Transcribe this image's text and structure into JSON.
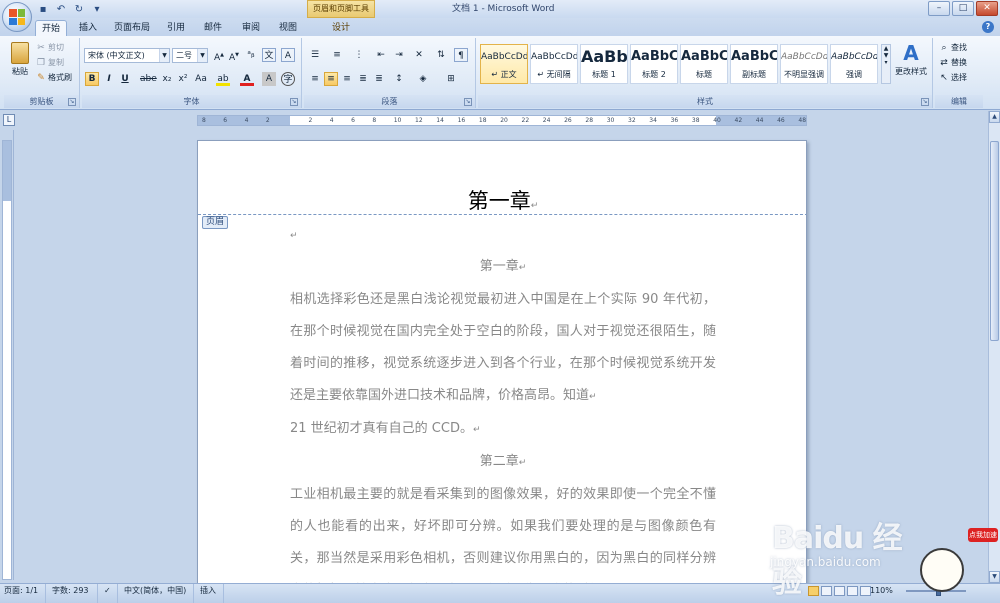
{
  "titlebar": {
    "context_tool": "页眉和页脚工具",
    "doc_title": "文档 1 - Microsoft Word"
  },
  "tabs": {
    "home": "开始",
    "insert": "插入",
    "layout": "页面布局",
    "references": "引用",
    "mailings": "邮件",
    "review": "审阅",
    "view": "视图",
    "design": "设计"
  },
  "clipboard": {
    "paste": "粘贴",
    "cut": "剪切",
    "copy": "复制",
    "format_painter": "格式刷",
    "label": "剪贴板"
  },
  "font": {
    "name": "宋体 (中文正文)",
    "size": "二号",
    "label": "字体"
  },
  "paragraph": {
    "label": "段落"
  },
  "styles": {
    "label": "样式",
    "items": [
      {
        "preview": "AaBbCcDd",
        "name": "↵ 正文"
      },
      {
        "preview": "AaBbCcDd",
        "name": "↵ 无间隔"
      },
      {
        "preview": "AaBb",
        "name": "标题 1"
      },
      {
        "preview": "AaBbC",
        "name": "标题 2"
      },
      {
        "preview": "AaBbC",
        "name": "标题"
      },
      {
        "preview": "AaBbC",
        "name": "副标题"
      },
      {
        "preview": "AaBbCcDd",
        "name": "不明显强调"
      },
      {
        "preview": "AaBbCcDd",
        "name": "强调"
      }
    ],
    "change_styles": "更改样式"
  },
  "editing": {
    "find": "查找",
    "replace": "替换",
    "select": "选择",
    "label": "编辑"
  },
  "ruler": {
    "ticks": [
      "8",
      "6",
      "4",
      "2",
      "",
      "2",
      "4",
      "6",
      "8",
      "10",
      "12",
      "14",
      "16",
      "18",
      "20",
      "22",
      "24",
      "26",
      "28",
      "30",
      "32",
      "34",
      "36",
      "38",
      "40",
      "42",
      "44",
      "46",
      "48"
    ]
  },
  "document": {
    "header_text": "第一章",
    "header_tag": "页眉",
    "para_mark": "↵",
    "chapter1": "第一章",
    "para1": "相机选择彩色还是黑白浅论视觉最初进入中国是在上个实际 90 年代初，在那个时候视觉在国内完全处于空白的阶段，国人对于视觉还很陌生，随着时间的推移，视觉系统逐步进入到各个行业，在那个时候视觉系统开发还是主要依靠国外进口技术和品牌，价格高昂。知道",
    "para1_tail": "21 世纪初才真有自己的 CCD。",
    "chapter2": "第二章",
    "para2": "工业相机最主要的就是看采集到的图像效果，好的效果即使一个完全不懂的人也能看的出来，好坏即可分辨。如果我们要处理的是与图像颜色有关，那当然是采用彩色相机，否则建议你用黑白的，因为黑白的同样分辨率的相机，精度比彩色高，尤其是在看图像边缘的时候"
  },
  "statusbar": {
    "page": "页面: 1/1",
    "words": "字数: 293",
    "language": "中文(简体，中国)",
    "mode": "插入",
    "zoom": "110%"
  },
  "watermark": {
    "brand": "Baidu 经验",
    "url": "jingyan.baidu.com",
    "badge": "点我加速"
  }
}
